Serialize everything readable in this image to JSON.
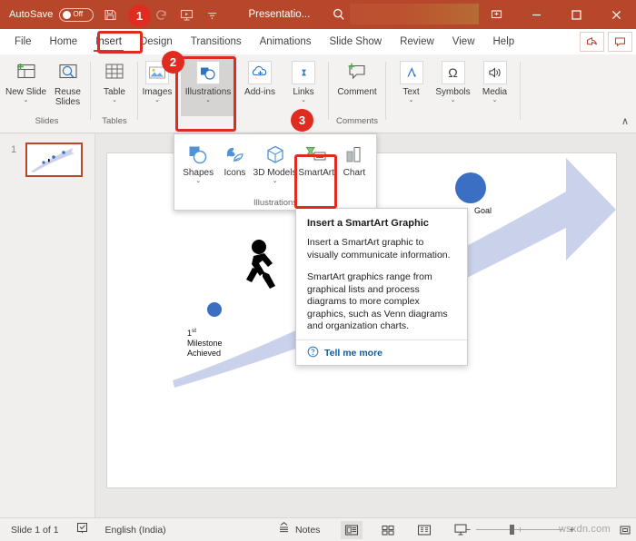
{
  "titlebar": {
    "autosave_label": "AutoSave",
    "autosave_state": "Off",
    "document_title": "Presentatio...",
    "icons": [
      "save-icon",
      "undo-icon",
      "redo-icon",
      "start-presentation-icon",
      "customize-qat-icon",
      "search-icon"
    ],
    "window_buttons": [
      "restore-down-icon",
      "minimize-icon",
      "maximize-icon",
      "close-icon"
    ],
    "bg_color": "#b7472a"
  },
  "ribbon_tabs": {
    "items": [
      {
        "label": "File",
        "active": false
      },
      {
        "label": "Home",
        "active": false
      },
      {
        "label": "Insert",
        "active": true
      },
      {
        "label": "Design",
        "active": false
      },
      {
        "label": "Transitions",
        "active": false
      },
      {
        "label": "Animations",
        "active": false
      },
      {
        "label": "Slide Show",
        "active": false
      },
      {
        "label": "Review",
        "active": false
      },
      {
        "label": "View",
        "active": false
      },
      {
        "label": "Help",
        "active": false
      }
    ],
    "right_buttons": [
      "share-icon",
      "comments-icon"
    ],
    "accent_color": "#b7472a"
  },
  "ribbon": {
    "groups": [
      {
        "name": "Slides",
        "label": "Slides",
        "buttons": [
          {
            "label": "New Slide",
            "icon": "new-slide-icon",
            "has_chevron": true
          },
          {
            "label": "Reuse Slides",
            "icon": "reuse-slides-icon",
            "has_chevron": false
          }
        ]
      },
      {
        "name": "Tables",
        "label": "Tables",
        "buttons": [
          {
            "label": "Table",
            "icon": "table-icon",
            "has_chevron": true
          }
        ]
      },
      {
        "name": "Illustrations",
        "label": "Illustrations",
        "buttons": [
          {
            "label": "Images",
            "icon": "images-icon",
            "has_chevron": true
          },
          {
            "label": "Illustrations",
            "icon": "illustrations-icon",
            "has_chevron": true
          }
        ]
      },
      {
        "name": "AddIns",
        "label": "",
        "buttons": [
          {
            "label": "Add-ins",
            "icon": "add-ins-icon",
            "has_chevron": true
          }
        ]
      },
      {
        "name": "Links",
        "label": "",
        "buttons": [
          {
            "label": "Links",
            "icon": "links-icon",
            "has_chevron": true
          }
        ]
      },
      {
        "name": "Comments",
        "label": "Comments",
        "buttons": [
          {
            "label": "Comment",
            "icon": "comment-icon",
            "has_chevron": false
          }
        ]
      },
      {
        "name": "TextSymbolsMedia",
        "label": "",
        "buttons": [
          {
            "label": "Text",
            "icon": "text-icon",
            "has_chevron": true
          },
          {
            "label": "Symbols",
            "icon": "symbols-icon",
            "has_chevron": true
          },
          {
            "label": "Media",
            "icon": "media-icon",
            "has_chevron": true
          }
        ]
      }
    ],
    "collapse_label": "∧"
  },
  "illustrations_dropdown": {
    "group_label": "Illustrations",
    "items": [
      {
        "label": "Shapes",
        "icon": "shapes-icon",
        "has_chevron": true,
        "selected": false
      },
      {
        "label": "Icons",
        "icon": "icons-icon",
        "has_chevron": false,
        "selected": false
      },
      {
        "label": "3D Models",
        "icon": "3d-models-icon",
        "has_chevron": true,
        "selected": false
      },
      {
        "label": "SmartArt",
        "icon": "smartart-icon",
        "has_chevron": false,
        "selected": true
      },
      {
        "label": "Chart",
        "icon": "chart-icon",
        "has_chevron": false,
        "selected": false
      }
    ]
  },
  "tooltip": {
    "title": "Insert a SmartArt Graphic",
    "paragraph1": "Insert a SmartArt graphic to visually communicate information.",
    "paragraph2": "SmartArt graphics range from graphical lists and process diagrams to more complex graphics, such as Venn diagrams and organization charts.",
    "link_label": "Tell me more",
    "link_icon": "help-circle-icon",
    "link_color": "#0f5a9c"
  },
  "thumbnail_pane": {
    "slide_number": "1"
  },
  "slide": {
    "labels": {
      "milestone_sup": "1",
      "milestone_sup_suffix": "st",
      "milestone_line2": "Milestone",
      "milestone_line3": "Achieved",
      "goal": "Goal"
    },
    "shape_colors": {
      "arrow_fill": "#c9d2ea",
      "dot_fill": "#3a6fc4",
      "figure_fill": "#000000"
    }
  },
  "statusbar": {
    "slide_indicator": "Slide 1 of 1",
    "accessibility_icon": "accessibility-checker-icon",
    "language": "English (India)",
    "notes_label": "Notes",
    "notes_icon": "notes-icon",
    "view_buttons": [
      {
        "name": "normal-view",
        "icon": "normal-view-icon",
        "active": true
      },
      {
        "name": "slide-sorter-view",
        "icon": "slide-sorter-icon",
        "active": false
      },
      {
        "name": "reading-view",
        "icon": "reading-view-icon",
        "active": false
      },
      {
        "name": "slide-show-view",
        "icon": "slide-show-icon",
        "active": false
      }
    ],
    "zoom_out_label": "−",
    "zoom_in_label": "+",
    "zoom_percent": "",
    "fit_icon": "fit-slide-icon"
  },
  "annotations": {
    "badges": [
      {
        "number": "1",
        "target": "insert-tab"
      },
      {
        "number": "2",
        "target": "illustrations-button"
      },
      {
        "number": "3",
        "target": "smartart-button"
      }
    ],
    "highlight_color": "#e02b20"
  },
  "watermark": {
    "text": "wsxdn.com"
  }
}
